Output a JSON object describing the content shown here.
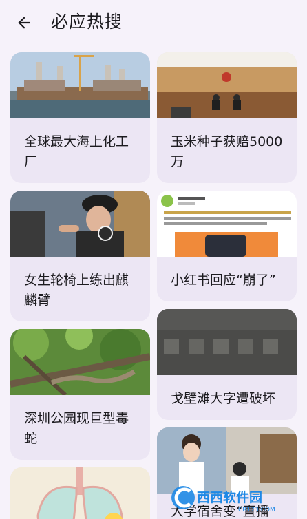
{
  "header": {
    "title": "必应热搜",
    "back_icon": "arrow-back-icon"
  },
  "cards": [
    {
      "caption": "全球最大海上化工厂",
      "image": "offshore-chemical-plant-image"
    },
    {
      "caption": "玉米种子获赔5000万",
      "image": "courtroom-image"
    },
    {
      "caption": "女生轮椅上练出麒麟臂",
      "image": "woman-workout-image"
    },
    {
      "caption": "小红书回应“崩了”",
      "image": "social-post-screenshot-image"
    },
    {
      "caption": "深圳公园现巨型毒蛇",
      "image": "snake-in-tree-image"
    },
    {
      "caption": "戈壁滩大字遭破坏",
      "image": "desert-characters-image"
    },
    {
      "caption": "",
      "image": "lungs-illustration-image"
    },
    {
      "caption": "大学宿舍变“直播",
      "image": "dorm-room-image"
    }
  ],
  "watermark": {
    "brand": "西西软件园",
    "url": "CR173.COM"
  },
  "colors": {
    "background": "#f6f2fa",
    "card": "#ece6f4",
    "text": "#1c1b1f"
  }
}
